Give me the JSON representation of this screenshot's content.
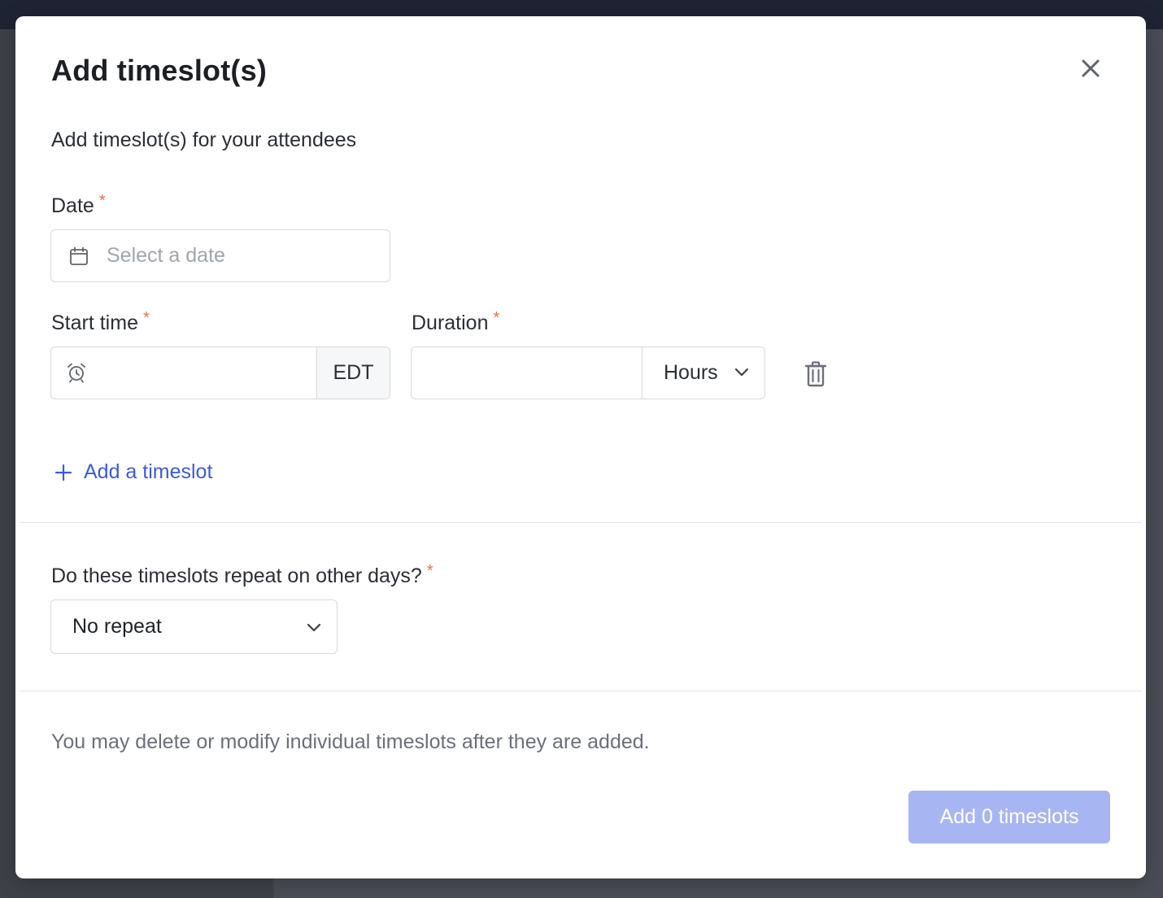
{
  "modal": {
    "title": "Add timeslot(s)",
    "subtitle": "Add timeslot(s) for your attendees",
    "required_marker": "*",
    "date": {
      "label": "Date",
      "placeholder": "Select a date"
    },
    "start_time": {
      "label": "Start time",
      "value": "",
      "timezone": "EDT"
    },
    "duration": {
      "label": "Duration",
      "value": "",
      "unit": "Hours"
    },
    "add_timeslot_link": "Add a timeslot",
    "repeat": {
      "label": "Do these timeslots repeat on other days?",
      "selected": "No repeat"
    },
    "note": "You may delete or modify individual timeslots after they are added.",
    "submit_label": "Add 0 timeslots"
  },
  "colors": {
    "accent": "#3b5bdb",
    "submit_disabled": "#a7b6f2",
    "required": "#e0734f",
    "overlay": "#4a4d55"
  }
}
